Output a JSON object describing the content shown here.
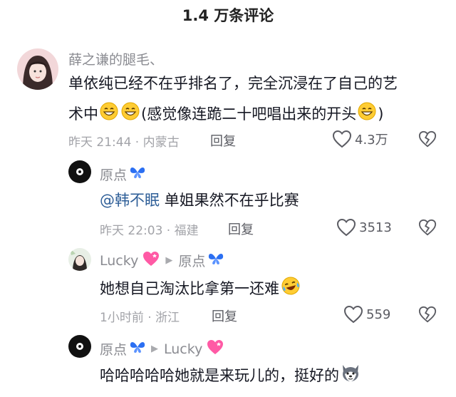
{
  "header": {
    "title": "1.4 万条评论"
  },
  "comments": [
    {
      "username": "薛之谦的腿毛、",
      "line1": "单依纯已经不在乎排名了，完全沉浸在了自己的艺",
      "line2_a": "术中",
      "line2_b": "(感觉像连跪二十吧唱出来的开头",
      "line2_c": ")",
      "meta": "昨天 21:44 · 内蒙古",
      "reply_label": "回复",
      "likes": "4.3万"
    },
    {
      "username": "原点",
      "mention": "@韩不眠",
      "text": " 单姐果然不在乎比赛",
      "meta": "昨天 22:03 · 福建",
      "reply_label": "回复",
      "likes": "3513"
    },
    {
      "username": "Lucky",
      "reply_to": "原点",
      "text": "她想自己淘汰比拿第一还难",
      "meta": "1小时前 · 浙江",
      "reply_label": "回复",
      "likes": "559"
    },
    {
      "username": "原点",
      "reply_to": "Lucky",
      "text": "哈哈哈哈哈她就是来玩儿的，挺好的"
    }
  ],
  "colors": {
    "text": "#161823",
    "secondary": "#8a8b91",
    "mention": "#2f5f98",
    "butterfly": "#2b6ff2",
    "heart": "#ff5aa5"
  },
  "icons": [
    "heart-outline-icon",
    "broken-heart-icon",
    "grin-emoji",
    "laugh-cry-emoji",
    "butterfly-emoji",
    "pink-heart-emoji",
    "husky-emoji",
    "triangle-right-icon"
  ]
}
